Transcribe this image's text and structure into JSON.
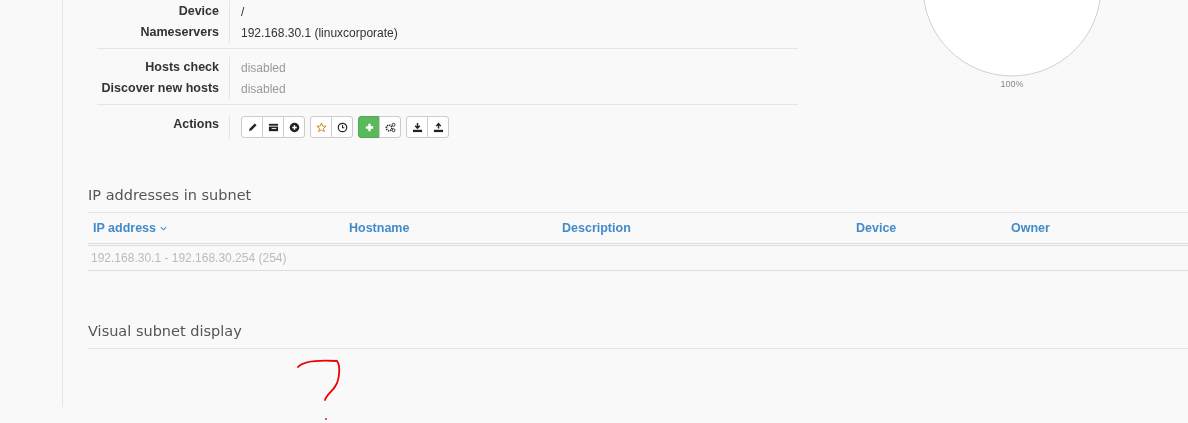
{
  "details": [
    {
      "rows": [
        {
          "label": "Device",
          "value": "/",
          "muted": false
        },
        {
          "label": "Nameservers",
          "value": "192.168.30.1 (linuxcorporate)",
          "muted": false
        }
      ]
    },
    {
      "rows": [
        {
          "label": "Hosts check",
          "value": "disabled",
          "muted": true
        },
        {
          "label": "Discover new hosts",
          "value": "disabled",
          "muted": true
        }
      ]
    }
  ],
  "actions": {
    "label": "Actions",
    "groups": [
      [
        {
          "kind": "pencil",
          "highlighted": false
        },
        {
          "kind": "list",
          "highlighted": false
        },
        {
          "kind": "plus-circle",
          "highlighted": false
        }
      ],
      [
        {
          "kind": "star",
          "highlighted": false
        },
        {
          "kind": "clock",
          "highlighted": false
        }
      ],
      [
        {
          "kind": "plus",
          "highlighted": true
        },
        {
          "kind": "gears",
          "highlighted": false
        }
      ],
      [
        {
          "kind": "download",
          "highlighted": false
        },
        {
          "kind": "upload",
          "highlighted": false
        }
      ]
    ]
  },
  "usage_chart": {
    "label": "100%"
  },
  "ip_section": {
    "title": "IP addresses in subnet",
    "columns": [
      {
        "label": "IP address",
        "sorted": true
      },
      {
        "label": "Hostname",
        "sorted": false
      },
      {
        "label": "Description",
        "sorted": false
      },
      {
        "label": "Device",
        "sorted": false
      },
      {
        "label": "Owner",
        "sorted": false
      }
    ],
    "rows": [
      {
        "text": "192.168.30.1 - 192.168.30.254 (254)"
      }
    ]
  },
  "visual_section": {
    "title": "Visual subnet display"
  }
}
